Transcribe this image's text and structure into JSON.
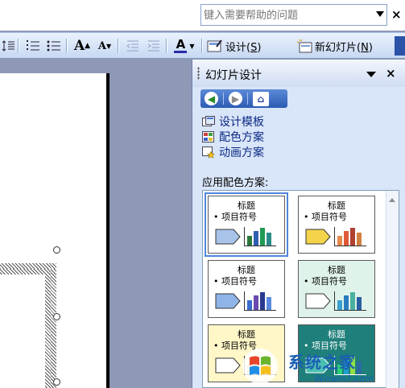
{
  "help": {
    "placeholder": "键入需要帮助的问题",
    "close_glyph": "×"
  },
  "toolbar": {
    "design_label": "设计(",
    "design_key": "S",
    "design_suffix": ")",
    "new_slide_label": "新幻灯片(",
    "new_slide_key": "N",
    "new_slide_suffix": ")",
    "font_color_glyph": "A",
    "grow_font_glyph": "A",
    "shrink_font_glyph": "A"
  },
  "pane": {
    "title": "幻灯片设计",
    "close_glyph": "×",
    "links": [
      {
        "label": "设计模板"
      },
      {
        "label": "配色方案"
      },
      {
        "label": "动画方案"
      }
    ],
    "section_label": "应用配色方案:",
    "schemes": [
      {
        "title": "标题",
        "bullet": "• 项目符号",
        "bg": "#ffffff",
        "arrow": "#a8c4ea",
        "bars": [
          "#2a7a3a",
          "#2f5fb0",
          "#1f9a55",
          "#2a8a8a"
        ],
        "selected": true
      },
      {
        "title": "标题",
        "bullet": "• 项目符号",
        "bg": "#ffffff",
        "arrow": "#f4d44a",
        "bars": [
          "#e8894a",
          "#e05a3a",
          "#b04030",
          "#d08040"
        ],
        "selected": false
      },
      {
        "title": "标题",
        "bullet": "• 项目符号",
        "bg": "#ffffff",
        "arrow": "#8fb4e8",
        "bars": [
          "#3a6ad0",
          "#6a4ab0",
          "#2a3a90",
          "#5a8ae0"
        ],
        "selected": false
      },
      {
        "title": "标题",
        "bullet": "• 项目符号",
        "bg": "#dff3ea",
        "arrow": "#ffffff",
        "bars": [
          "#3aa0d0",
          "#2a7ac0",
          "#4ab0a0",
          "#2a60a0"
        ],
        "selected": false
      },
      {
        "title": "标题",
        "bullet": "• 项目符号",
        "bg": "#fff7c8",
        "arrow": "#ffffff",
        "bars": [
          "#d8c080",
          "#c0a060",
          "#e0d090",
          "#b09050"
        ],
        "selected": false
      },
      {
        "title": "标题",
        "bullet": "• 项目符号",
        "bg": "#1f7f7a",
        "arrow": "#4cc0b0",
        "bars": [
          "#2fd07a",
          "#1fa0d0",
          "#8fe04a",
          "#2a6aa0"
        ],
        "selected": false
      }
    ]
  },
  "watermark": {
    "title": "系统之家",
    "url": "Winwin7.com"
  }
}
